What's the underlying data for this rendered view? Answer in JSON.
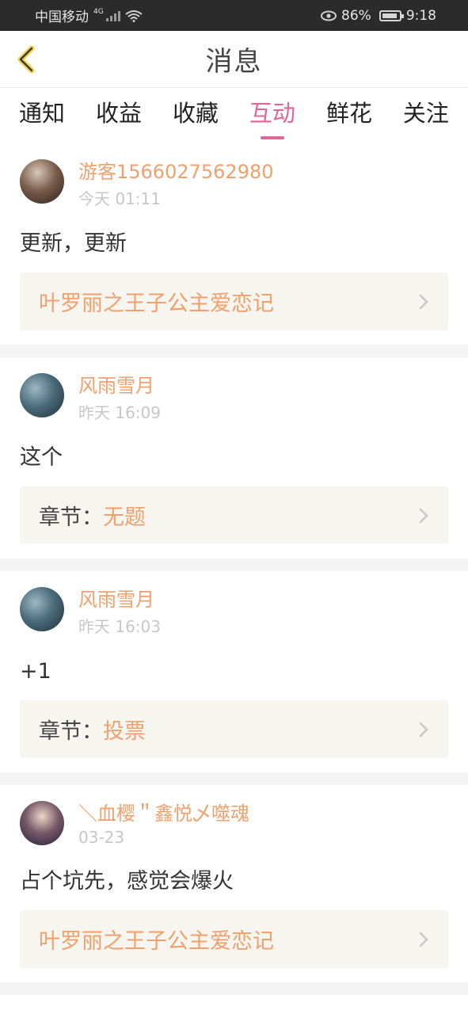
{
  "status": {
    "carrier": "中国移动",
    "network": "4G",
    "battery": "86%",
    "time": "9:18"
  },
  "header": {
    "title": "消息"
  },
  "tabs": [
    {
      "label": "通知"
    },
    {
      "label": "收益"
    },
    {
      "label": "收藏"
    },
    {
      "label": "互动",
      "active": true
    },
    {
      "label": "鲜花"
    },
    {
      "label": "关注"
    }
  ],
  "items": [
    {
      "username": "游客1566027562980",
      "time": "今天 01:11",
      "content": "更新，更新",
      "ref_prefix": "",
      "ref_title": "叶罗丽之王子公主爱恋记"
    },
    {
      "username": "风雨雪月",
      "time": "昨天 16:09",
      "content": "这个",
      "ref_prefix": "章节：",
      "ref_title": "无题"
    },
    {
      "username": "风雨雪月",
      "time": "昨天 16:03",
      "content": "+1",
      "ref_prefix": "章节：",
      "ref_title": "投票"
    },
    {
      "username": "＼血樱＂鑫悦乄噬魂",
      "time": "03-23",
      "content": "占个坑先，感觉会爆火",
      "ref_prefix": "",
      "ref_title": "叶罗丽之王子公主爱恋记"
    }
  ],
  "colors": {
    "accent": "#e2659a",
    "orange": "#f0a06c"
  }
}
